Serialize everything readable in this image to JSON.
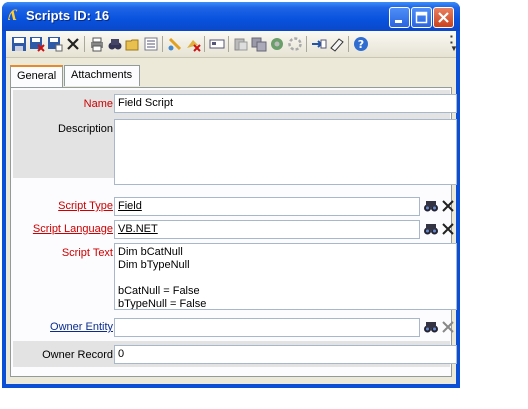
{
  "window": {
    "title": "Scripts ID: 16",
    "app_icon": "script-app-icon"
  },
  "toolbar": {
    "icons": [
      "save-icon",
      "save-close-icon",
      "save-new-icon",
      "delete-icon",
      "print-icon",
      "find-icon",
      "open-folder-icon",
      "list-icon",
      "run-icon",
      "clear-icon",
      "copy-icon",
      "paste-icon",
      "export-icon",
      "refresh-icon",
      "spinner-icon",
      "link-icon",
      "notes-icon",
      "help-icon"
    ]
  },
  "tabs": [
    {
      "label": "General",
      "active": true
    },
    {
      "label": "Attachments",
      "active": false
    }
  ],
  "form": {
    "name": {
      "label": "Name",
      "value": "Field Script"
    },
    "description": {
      "label": "Description",
      "value": ""
    },
    "script_type": {
      "label": "Script Type",
      "value": "Field"
    },
    "script_language": {
      "label": "Script Language",
      "value": "VB.NET"
    },
    "script_text": {
      "label": "Script Text",
      "value": "Dim bCatNull\nDim bTypeNull\n\nbCatNull = False\nbTypeNull = False"
    },
    "owner_entity": {
      "label": "Owner Entity",
      "value": ""
    },
    "owner_record": {
      "label": "Owner Record",
      "value": "0"
    }
  },
  "colors": {
    "title_blue": "#0852dd",
    "required_label": "#cc0000",
    "link_label": "#0b2c8c",
    "active_tab_accent": "#e68b2c"
  }
}
